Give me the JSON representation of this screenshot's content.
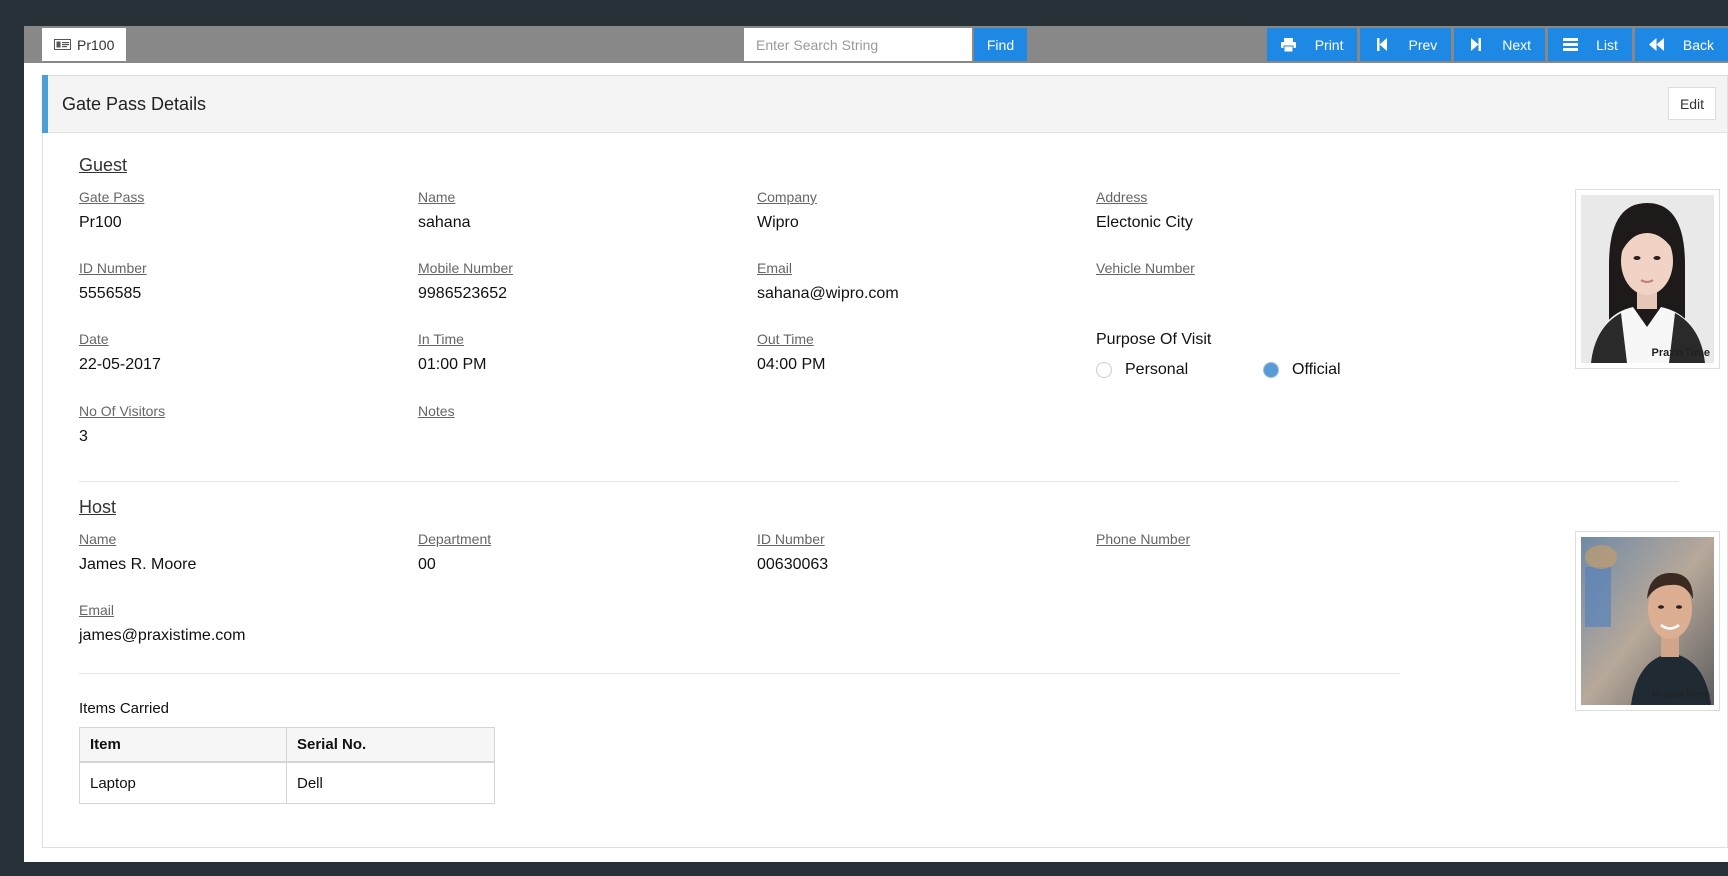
{
  "toolbar": {
    "record_tab": "Pr100",
    "search_placeholder": "Enter Search String",
    "find_label": "Find",
    "print_label": "Print",
    "prev_label": "Prev",
    "next_label": "Next",
    "list_label": "List",
    "back_label": "Back"
  },
  "panel": {
    "title": "Gate Pass Details",
    "edit_label": "Edit"
  },
  "guest": {
    "section_title": "Guest",
    "gate_pass": {
      "label": "Gate Pass",
      "value": "Pr100"
    },
    "name": {
      "label": "Name",
      "value": "sahana"
    },
    "company": {
      "label": "Company",
      "value": "Wipro"
    },
    "address": {
      "label": "Address",
      "value": "Electonic City"
    },
    "id_number": {
      "label": "ID Number",
      "value": "5556585"
    },
    "mobile_number": {
      "label": "Mobile Number",
      "value": "9986523652"
    },
    "email": {
      "label": "Email",
      "value": "sahana@wipro.com"
    },
    "vehicle_number": {
      "label": "Vehicle Number",
      "value": ""
    },
    "date": {
      "label": "Date",
      "value": "22-05-2017"
    },
    "in_time": {
      "label": "In Time",
      "value": "01:00 PM"
    },
    "out_time": {
      "label": "Out Time",
      "value": "04:00 PM"
    },
    "purpose": {
      "label": "Purpose Of Visit",
      "options": [
        "Personal",
        "Official"
      ],
      "selected": "Official"
    },
    "no_of_visitors": {
      "label": "No Of Visitors",
      "value": "3"
    },
    "notes": {
      "label": "Notes",
      "value": ""
    },
    "photo_watermark": "PraxisTime"
  },
  "host": {
    "section_title": "Host",
    "name": {
      "label": "Name",
      "value": "James R. Moore"
    },
    "department": {
      "label": "Department",
      "value": "00"
    },
    "id_number": {
      "label": "ID Number",
      "value": "00630063"
    },
    "phone_number": {
      "label": "Phone Number",
      "value": ""
    },
    "email": {
      "label": "Email",
      "value": "james@praxistime.com"
    }
  },
  "items_carried": {
    "label": "Items Carried",
    "columns": [
      "Item",
      "Serial No."
    ],
    "rows": [
      [
        "Laptop",
        "Dell"
      ]
    ]
  },
  "colors": {
    "accent": "#1e88e5",
    "toolbar_bg": "#888888",
    "panel_accent": "#4a9fd6",
    "background": "#263238"
  }
}
